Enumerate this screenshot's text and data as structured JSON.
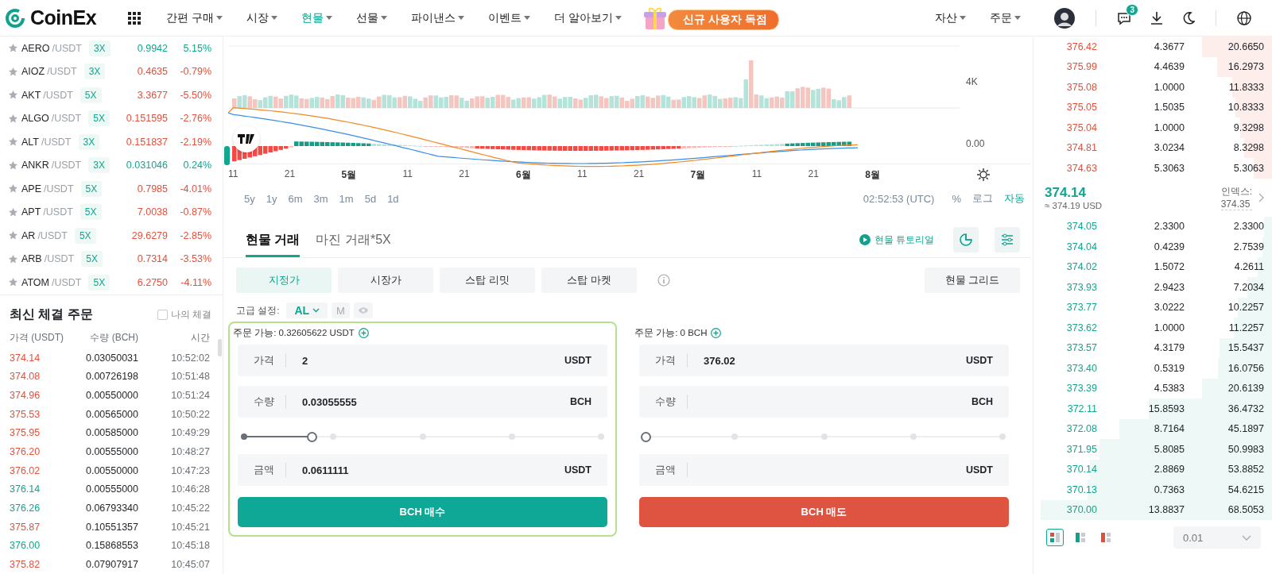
{
  "header": {
    "logo": "CoinEx",
    "nav": [
      {
        "label": "간편 구매",
        "selected": false
      },
      {
        "label": "시장",
        "selected": false
      },
      {
        "label": "현물",
        "selected": true
      },
      {
        "label": "선물",
        "selected": false
      },
      {
        "label": "파이낸스",
        "selected": false
      },
      {
        "label": "이벤트",
        "selected": false
      },
      {
        "label": "더 알아보기",
        "selected": false
      }
    ],
    "promo": "신규 사용자 독점",
    "menus": [
      "자산",
      "주문"
    ],
    "notification_count": "3"
  },
  "markets": [
    {
      "base": "AERO",
      "quote": "/USDT",
      "leverage": "3X",
      "price": "0.9942",
      "change": "5.15%",
      "up": true
    },
    {
      "base": "AIOZ",
      "quote": "/USDT",
      "leverage": "3X",
      "price": "0.4635",
      "change": "-0.79%",
      "up": false
    },
    {
      "base": "AKT",
      "quote": "/USDT",
      "leverage": "5X",
      "price": "3.3677",
      "change": "-5.50%",
      "up": false
    },
    {
      "base": "ALGO",
      "quote": "/USDT",
      "leverage": "5X",
      "price": "0.151595",
      "change": "-2.76%",
      "up": false
    },
    {
      "base": "ALT",
      "quote": "/USDT",
      "leverage": "3X",
      "price": "0.151837",
      "change": "-2.19%",
      "up": false
    },
    {
      "base": "ANKR",
      "quote": "/USDT",
      "leverage": "3X",
      "price": "0.031046",
      "change": "0.24%",
      "up": true
    },
    {
      "base": "APE",
      "quote": "/USDT",
      "leverage": "5X",
      "price": "0.7985",
      "change": "-4.01%",
      "up": false
    },
    {
      "base": "APT",
      "quote": "/USDT",
      "leverage": "5X",
      "price": "7.0038",
      "change": "-0.87%",
      "up": false
    },
    {
      "base": "AR",
      "quote": "/USDT",
      "leverage": "5X",
      "price": "29.6279",
      "change": "-2.85%",
      "up": false
    },
    {
      "base": "ARB",
      "quote": "/USDT",
      "leverage": "5X",
      "price": "0.7314",
      "change": "-3.53%",
      "up": false
    },
    {
      "base": "ATOM",
      "quote": "/USDT",
      "leverage": "5X",
      "price": "6.2750",
      "change": "-4.11%",
      "up": false
    }
  ],
  "trades": {
    "title": "최신 체결 주문",
    "my_trades": {
      "label": "나의 체결",
      "checked": false
    },
    "columns": [
      "가격 (USDT)",
      "수량 (BCH)",
      "시간"
    ],
    "rows": [
      {
        "price": "374.14",
        "amount": "0.03050031",
        "time": "10:52:02",
        "buy": false
      },
      {
        "price": "374.08",
        "amount": "0.00726198",
        "time": "10:51:48",
        "buy": false
      },
      {
        "price": "374.96",
        "amount": "0.00550000",
        "time": "10:51:24",
        "buy": false
      },
      {
        "price": "375.53",
        "amount": "0.00565000",
        "time": "10:50:22",
        "buy": false
      },
      {
        "price": "375.95",
        "amount": "0.00585000",
        "time": "10:49:29",
        "buy": false
      },
      {
        "price": "376.20",
        "amount": "0.00555000",
        "time": "10:48:27",
        "buy": false
      },
      {
        "price": "376.02",
        "amount": "0.00550000",
        "time": "10:47:23",
        "buy": false
      },
      {
        "price": "376.14",
        "amount": "0.00555000",
        "time": "10:46:28",
        "buy": true
      },
      {
        "price": "376.26",
        "amount": "0.06793340",
        "time": "10:45:22",
        "buy": true
      },
      {
        "price": "375.87",
        "amount": "0.10551357",
        "time": "10:45:21",
        "buy": false
      },
      {
        "price": "376.00",
        "amount": "0.15868553",
        "time": "10:45:18",
        "buy": true
      },
      {
        "price": "375.82",
        "amount": "0.07907917",
        "time": "10:45:07",
        "buy": false
      }
    ]
  },
  "chart": {
    "x_labels": [
      {
        "text": "11",
        "bold": false
      },
      {
        "text": "21",
        "bold": false
      },
      {
        "text": "5월",
        "bold": true
      },
      {
        "text": "11",
        "bold": false
      },
      {
        "text": "21",
        "bold": false
      },
      {
        "text": "6월",
        "bold": true
      },
      {
        "text": "11",
        "bold": false
      },
      {
        "text": "21",
        "bold": false
      },
      {
        "text": "7월",
        "bold": true
      },
      {
        "text": "11",
        "bold": false
      },
      {
        "text": "21",
        "bold": false
      },
      {
        "text": "8월",
        "bold": true
      }
    ],
    "y_labels": [
      "4K",
      "0.00"
    ],
    "periods": [
      "5y",
      "1y",
      "6m",
      "3m",
      "1m",
      "5d",
      "1d"
    ],
    "time": "02:52:53 (UTC)",
    "scale_options": [
      {
        "label": "%",
        "selected": false
      },
      {
        "label": "로그",
        "selected": false
      },
      {
        "label": "자동",
        "selected": true
      }
    ]
  },
  "trade_tabs": [
    {
      "label": "현물 거래",
      "selected": true
    },
    {
      "label": "마진 거래*5X",
      "selected": false
    }
  ],
  "tutorial": "현물 튜토리얼",
  "order_types": [
    {
      "label": "지정가",
      "selected": true
    },
    {
      "label": "시장가",
      "selected": false
    },
    {
      "label": "스탑 리밋",
      "selected": false
    },
    {
      "label": "스탑 마켓",
      "selected": false
    }
  ],
  "grid_button": "현물 그리드",
  "advanced": {
    "label": "고급 설정:",
    "mode": "AL",
    "m": "M"
  },
  "forms": [
    {
      "kind": "buy",
      "active": true,
      "available_label": "주문 가능:",
      "available": "0.32605622",
      "available_unit": "USDT",
      "fields": [
        {
          "label": "가격",
          "value": "2",
          "unit": "USDT"
        },
        {
          "label": "수량",
          "value": "0.03055555",
          "unit": "BCH"
        },
        {
          "label": "금액",
          "value": "0.0611111",
          "unit": "USDT"
        }
      ],
      "level": 0.19,
      "button": "BCH 매수"
    },
    {
      "kind": "sell",
      "active": false,
      "available_label": "주문 가능:",
      "available": "0",
      "available_unit": "BCH",
      "fields": [
        {
          "label": "가격",
          "value": "376.02",
          "unit": "USDT"
        },
        {
          "label": "수량",
          "unit": "BCH"
        },
        {
          "label": "금액",
          "unit": "USDT"
        }
      ],
      "level": 0,
      "button": "BCH 매도"
    }
  ],
  "orderbook": {
    "asks": [
      {
        "price": "376.42",
        "amount": "4.3677",
        "total": "20.6650"
      },
      {
        "price": "375.99",
        "amount": "4.4639",
        "total": "16.2973"
      },
      {
        "price": "375.08",
        "amount": "1.0000",
        "total": "11.8333"
      },
      {
        "price": "375.05",
        "amount": "1.5035",
        "total": "10.8333"
      },
      {
        "price": "375.04",
        "amount": "1.0000",
        "total": "9.3298"
      },
      {
        "price": "374.81",
        "amount": "3.0234",
        "total": "8.3298"
      },
      {
        "price": "374.63",
        "amount": "5.3063",
        "total": "5.3063"
      }
    ],
    "last_price": "374.14",
    "last_price_usd": "≈ 374.19 USD",
    "index_label": "인덱스:",
    "index_value": "374.35",
    "bids": [
      {
        "price": "374.05",
        "amount": "2.3300",
        "total": "2.3300"
      },
      {
        "price": "374.04",
        "amount": "0.4239",
        "total": "2.7539"
      },
      {
        "price": "374.02",
        "amount": "1.5072",
        "total": "4.2611"
      },
      {
        "price": "373.93",
        "amount": "2.9423",
        "total": "7.2034"
      },
      {
        "price": "373.77",
        "amount": "3.0222",
        "total": "10.2257"
      },
      {
        "price": "373.62",
        "amount": "1.0000",
        "total": "11.2257"
      },
      {
        "price": "373.57",
        "amount": "4.3179",
        "total": "15.5437"
      },
      {
        "price": "373.40",
        "amount": "0.5319",
        "total": "16.0756"
      },
      {
        "price": "373.39",
        "amount": "4.5383",
        "total": "20.6139"
      },
      {
        "price": "372.11",
        "amount": "15.8593",
        "total": "36.4732"
      },
      {
        "price": "372.08",
        "amount": "8.7164",
        "total": "45.1897"
      },
      {
        "price": "371.95",
        "amount": "5.8085",
        "total": "50.9983"
      },
      {
        "price": "370.14",
        "amount": "2.8869",
        "total": "53.8852"
      },
      {
        "price": "370.13",
        "amount": "0.7363",
        "total": "54.6215"
      },
      {
        "price": "370.00",
        "amount": "13.8837",
        "total": "68.5053"
      }
    ],
    "views": [
      {
        "kind": "both",
        "selected": true
      },
      {
        "kind": "bids",
        "selected": false
      },
      {
        "kind": "asks",
        "selected": false
      }
    ],
    "precision": "0.01"
  }
}
